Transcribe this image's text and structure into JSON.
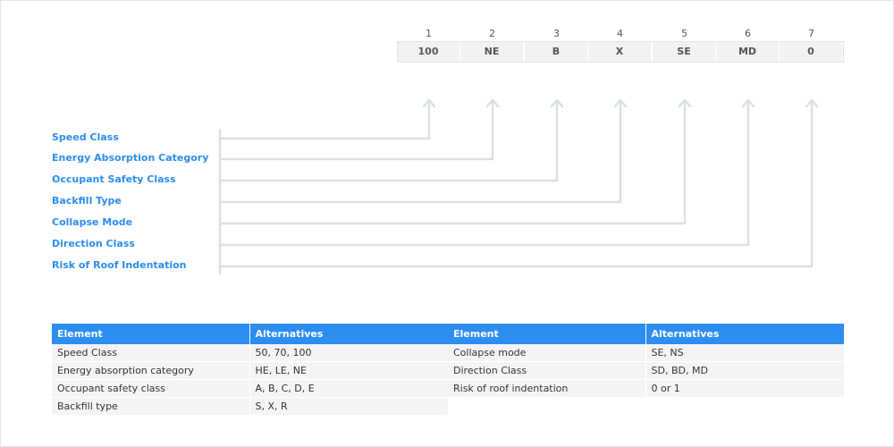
{
  "code": {
    "positions": [
      "1",
      "2",
      "3",
      "4",
      "5",
      "6",
      "7"
    ],
    "values": [
      "100",
      "NE",
      "B",
      "X",
      "SE",
      "MD",
      "0"
    ]
  },
  "labels": [
    "Speed Class",
    "Energy Absorption Category",
    "Occupant Safety Class",
    "Backfill Type",
    "Collapse Mode",
    "Direction Class",
    "Risk of Roof Indentation"
  ],
  "colors": {
    "accent": "#2b8ef0",
    "connector": "#dce1e6",
    "cell_bg": "#f2f2f2"
  },
  "tables": {
    "left": {
      "headers": [
        "Element",
        "Alternatives"
      ],
      "rows": [
        [
          "Speed Class",
          "50, 70, 100"
        ],
        [
          "Energy absorption category",
          "HE, LE, NE"
        ],
        [
          "Occupant safety class",
          "A, B, C, D, E"
        ],
        [
          "Backfill type",
          "S, X, R"
        ]
      ]
    },
    "right": {
      "headers": [
        "Element",
        "Alternatives"
      ],
      "rows": [
        [
          "Collapse mode",
          "SE, NS"
        ],
        [
          "Direction Class",
          "SD, BD, MD"
        ],
        [
          "Risk of roof indentation",
          "0 or 1"
        ]
      ]
    }
  }
}
